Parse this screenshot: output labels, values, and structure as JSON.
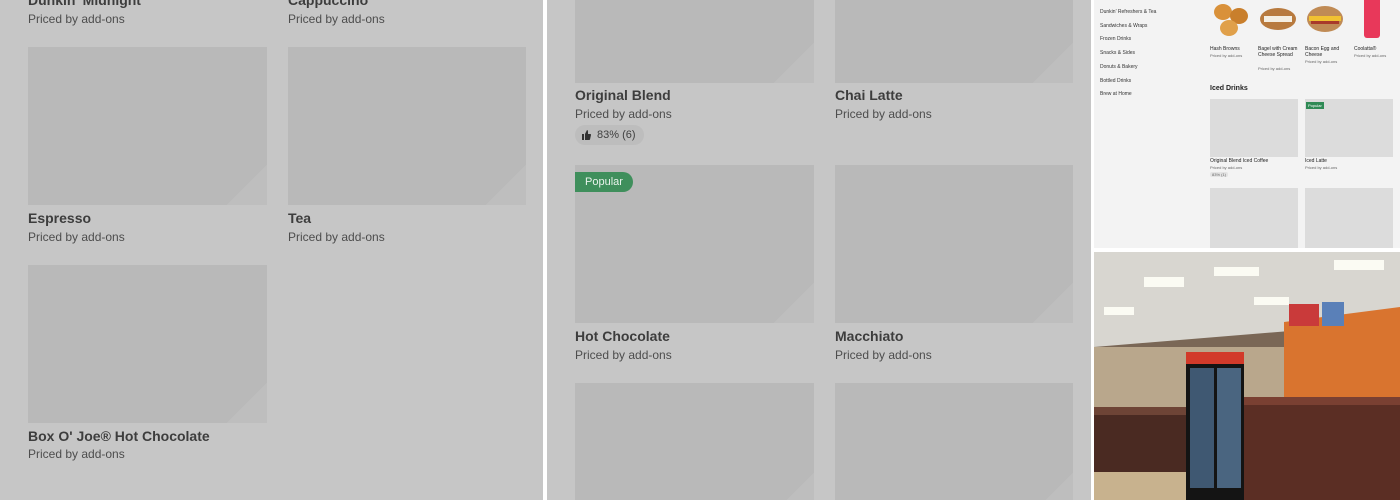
{
  "left_panel": {
    "items": [
      {
        "name": "Dunkin' Midnight",
        "price": "Priced by add-ons"
      },
      {
        "name": "Cappuccino",
        "price": "Priced by add-ons"
      },
      {
        "name": "Espresso",
        "price": "Priced by add-ons"
      },
      {
        "name": "Tea",
        "price": "Priced by add-ons"
      },
      {
        "name": "Box O' Joe® Hot Chocolate",
        "price": "Priced by add-ons"
      }
    ]
  },
  "mid_panel": {
    "items": [
      {
        "name": "Original Blend",
        "price": "Priced by add-ons",
        "rating": "83% (6)"
      },
      {
        "name": "Chai Latte",
        "price": "Priced by add-ons"
      },
      {
        "name": "Hot Chocolate",
        "price": "Priced by add-ons",
        "badge": "Popular"
      },
      {
        "name": "Macchiato",
        "price": "Priced by add-ons"
      }
    ]
  },
  "menu_panel": {
    "categories": [
      "Dunkin' Refreshers & Tea",
      "Sandwiches & Wraps",
      "Frozen Drinks",
      "Snacks & Sides",
      "Donuts & Bakery",
      "Bottled Drinks",
      "Brew at Home"
    ],
    "top_items": [
      {
        "name": "Hash Browns",
        "price": "Priced by add-ons"
      },
      {
        "name": "Bagel with Cream Cheese Spread",
        "price": "Priced by add-ons"
      },
      {
        "name": "Bacon Egg and Cheese",
        "price": "Priced by add-ons"
      },
      {
        "name": "Coolatta®",
        "price": "Priced by add-ons"
      }
    ],
    "section_title": "Iced Drinks",
    "iced_items": [
      {
        "name": "Original Blend Iced Coffee",
        "price": "Priced by add-ons",
        "rating": "83% (1)"
      },
      {
        "name": "Iced Latte",
        "price": "Priced by add-ons",
        "badge": "Popular"
      }
    ]
  },
  "colors": {
    "overlay": "#c6c6c6",
    "tile": "#b9b9b9",
    "badge": "#3f8f5c"
  },
  "icons": {
    "rating": "thumbs-up-icon"
  }
}
